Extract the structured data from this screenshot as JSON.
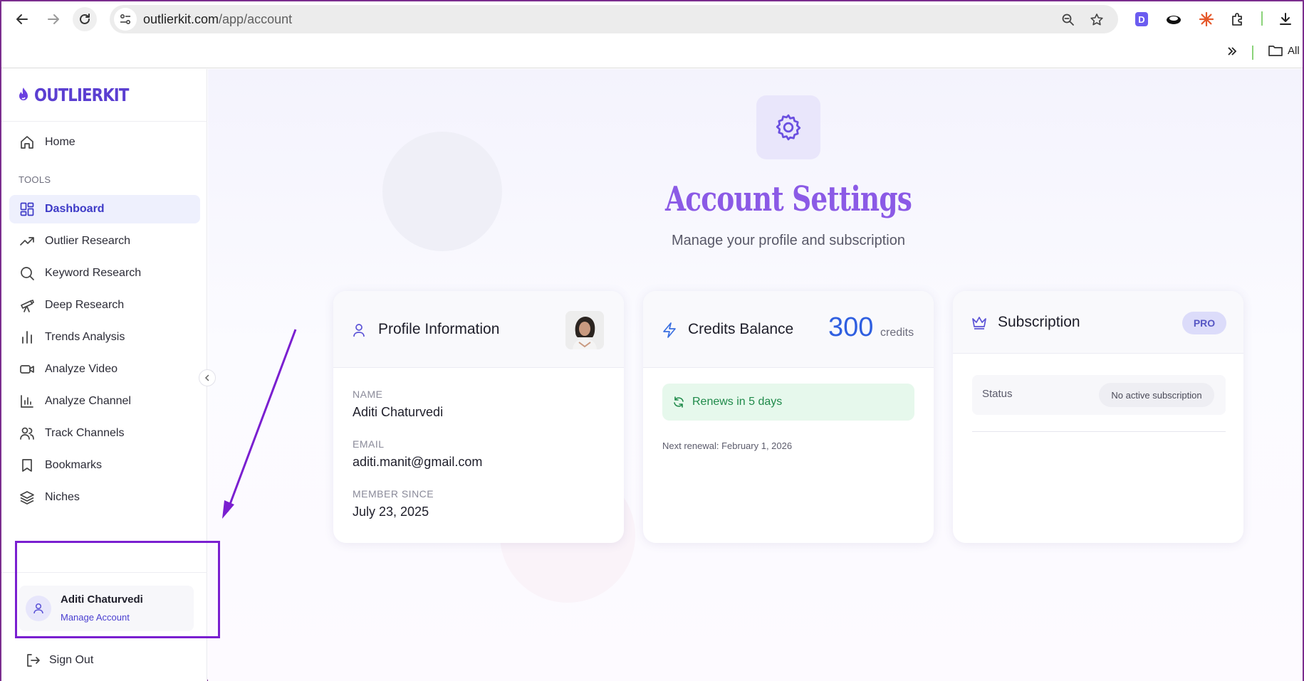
{
  "browser": {
    "url_host": "outlierkit.com",
    "url_path": "/app/account",
    "bookmarks_all_label": "All"
  },
  "sidebar": {
    "logo_text": "OUTLIERKIT",
    "home_label": "Home",
    "tools_section_label": "TOOLS",
    "items": [
      {
        "label": "Dashboard",
        "icon": "dashboard-icon",
        "active": true
      },
      {
        "label": "Outlier Research",
        "icon": "trending-up-icon"
      },
      {
        "label": "Keyword Research",
        "icon": "search-icon"
      },
      {
        "label": "Deep Research",
        "icon": "telescope-icon"
      },
      {
        "label": "Trends Analysis",
        "icon": "bar-chart-icon"
      },
      {
        "label": "Analyze Video",
        "icon": "video-icon"
      },
      {
        "label": "Analyze Channel",
        "icon": "channel-chart-icon"
      },
      {
        "label": "Track Channels",
        "icon": "users-icon"
      },
      {
        "label": "Bookmarks",
        "icon": "bookmark-icon"
      },
      {
        "label": "Niches",
        "icon": "layers-icon"
      }
    ],
    "user": {
      "name": "Aditi Chaturvedi",
      "manage_label": "Manage Account"
    },
    "sign_out_label": "Sign Out"
  },
  "main": {
    "title": "Account Settings",
    "subtitle": "Manage your profile and subscription",
    "profile": {
      "title": "Profile Information",
      "name_label": "NAME",
      "name_value": "Aditi Chaturvedi",
      "email_label": "EMAIL",
      "email_value": "aditi.manit@gmail.com",
      "member_label": "MEMBER SINCE",
      "member_value": "July 23, 2025"
    },
    "credits": {
      "title": "Credits Balance",
      "amount": "300",
      "unit": "credits",
      "renew_text": "Renews in 5 days",
      "next_renewal": "Next renewal: February 1, 2026"
    },
    "subscription": {
      "title": "Subscription",
      "badge": "PRO",
      "status_label": "Status",
      "status_value": "No active subscription"
    }
  },
  "colors": {
    "accent": "#5b3fd1",
    "title": "#8b5ae6",
    "credits": "#2f5fe0",
    "renew_bg": "#e6f8ec",
    "renew_text": "#1f8a4a",
    "annotation": "#7a1fd0"
  }
}
